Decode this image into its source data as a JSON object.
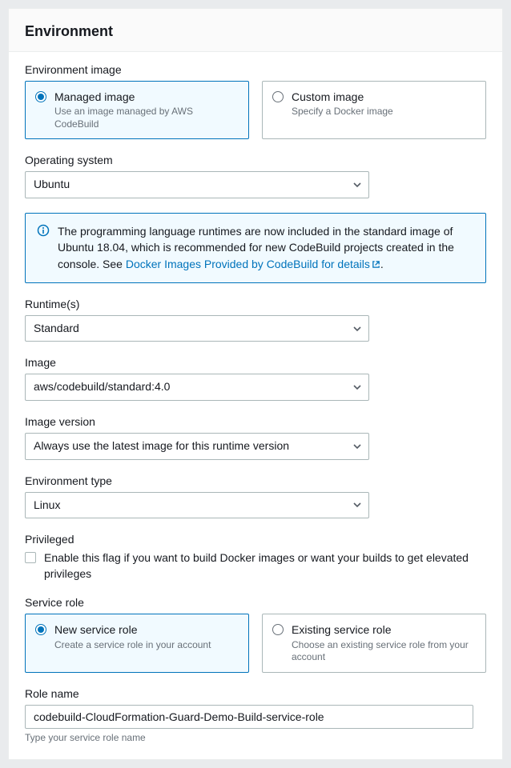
{
  "header": {
    "title": "Environment"
  },
  "envImage": {
    "label": "Environment image",
    "options": [
      {
        "title": "Managed image",
        "sub": "Use an image managed by AWS CodeBuild",
        "selected": true
      },
      {
        "title": "Custom image",
        "sub": "Specify a Docker image",
        "selected": false
      }
    ]
  },
  "os": {
    "label": "Operating system",
    "value": "Ubuntu"
  },
  "info": {
    "text_before": "The programming language runtimes are now included in the standard image of Ubuntu 18.04, which is recommended for new CodeBuild projects created in the console. See ",
    "link_text": "Docker Images Provided by CodeBuild for details",
    "text_after": "."
  },
  "runtimes": {
    "label": "Runtime(s)",
    "value": "Standard"
  },
  "image": {
    "label": "Image",
    "value": "aws/codebuild/standard:4.0"
  },
  "imageVersion": {
    "label": "Image version",
    "value": "Always use the latest image for this runtime version"
  },
  "envType": {
    "label": "Environment type",
    "value": "Linux"
  },
  "privileged": {
    "label": "Privileged",
    "checkbox_label": "Enable this flag if you want to build Docker images or want your builds to get elevated privileges",
    "checked": false
  },
  "serviceRole": {
    "label": "Service role",
    "options": [
      {
        "title": "New service role",
        "sub": "Create a service role in your account",
        "selected": true
      },
      {
        "title": "Existing service role",
        "sub": "Choose an existing service role from your account",
        "selected": false
      }
    ]
  },
  "roleName": {
    "label": "Role name",
    "value": "codebuild-CloudFormation-Guard-Demo-Build-service-role",
    "hint": "Type your service role name"
  }
}
